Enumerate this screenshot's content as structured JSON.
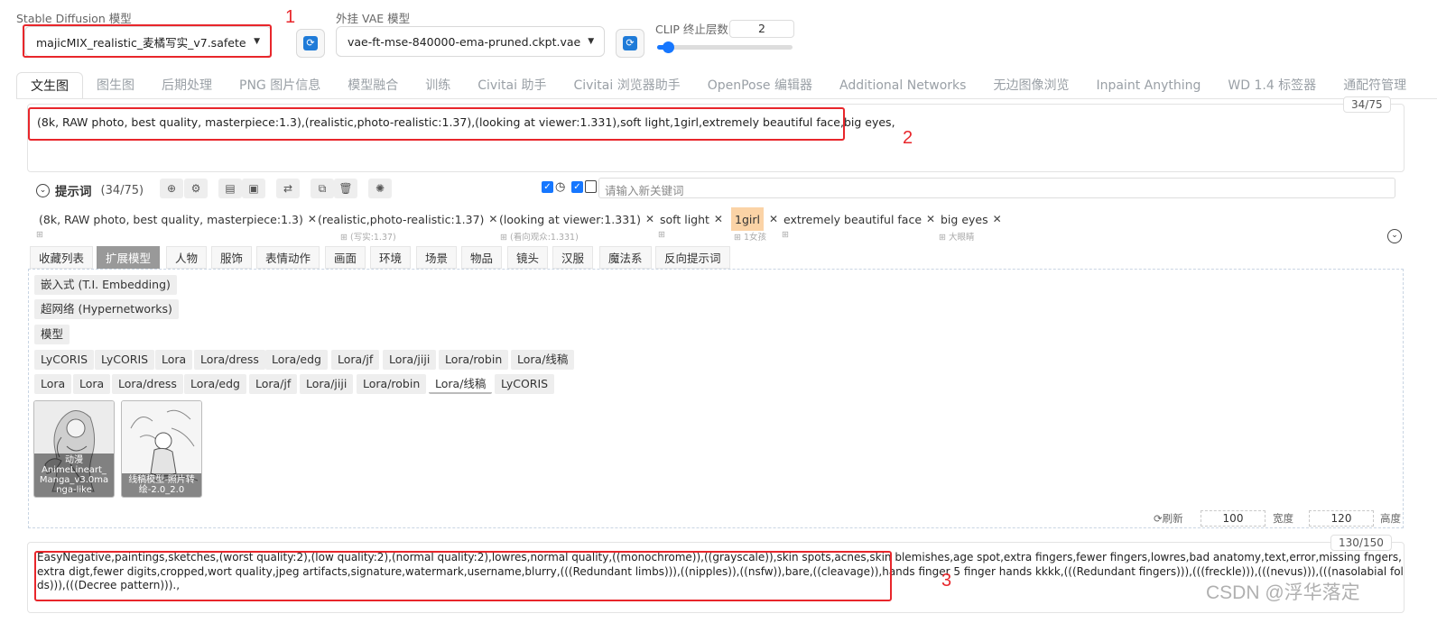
{
  "models": {
    "sd_label": "Stable Diffusion 模型",
    "sd_value": "majicMIX_realistic_麦橘写实_v7.safetensor",
    "vae_label": "外挂 VAE 模型",
    "vae_value": "vae-ft-mse-840000-ema-pruned.ckpt.vae",
    "clip_label": "CLIP 终止层数",
    "clip_value": "2",
    "clip_slider_fraction": 0.08
  },
  "tabs": [
    "文生图",
    "图生图",
    "后期处理",
    "PNG 图片信息",
    "模型融合",
    "训练",
    "Civitai 助手",
    "Civitai 浏览器助手",
    "OpenPose 编辑器",
    "Additional Networks",
    "无边图像浏览",
    "Inpaint Anything",
    "WD 1.4 标签器",
    "通配符管理"
  ],
  "annotations": {
    "n1": "1",
    "n2": "2",
    "n3": "3"
  },
  "prompt": {
    "text": "(8k, RAW photo, best quality, masterpiece:1.3),(realistic,photo-realistic:1.37),(looking at viewer:1.331),soft light,1girl,extremely beautiful face,big eyes,",
    "counter": "34/75"
  },
  "helper": {
    "title": "提示词",
    "count": "(34/75)",
    "keyword_placeholder": "请输入新关键词"
  },
  "tags": [
    {
      "text": "(8k, RAW photo, best quality, masterpiece:1.3)",
      "sub": ""
    },
    {
      "text": "(realistic,photo-realistic:1.37)",
      "sub": "(写实:1.37)"
    },
    {
      "text": "(looking at viewer:1.331)",
      "sub": "(看向观众:1.331)"
    },
    {
      "text": "soft light",
      "sub": ""
    },
    {
      "text": "1girl",
      "sub": "1女孩"
    },
    {
      "text": "extremely beautiful face",
      "sub": ""
    },
    {
      "text": "big eyes",
      "sub": "大眼睛"
    }
  ],
  "categories": [
    "收藏列表",
    "扩展模型",
    "人物",
    "服饰",
    "表情动作",
    "画面",
    "环境",
    "场景",
    "物品",
    "镜头",
    "汉服",
    "魔法系",
    "反向提示词"
  ],
  "ext_groups": {
    "embedding": "嵌入式 (T.I. Embedding)",
    "hypernetworks": "超网络 (Hypernetworks)",
    "model": "模型"
  },
  "row1": [
    "LyCORIS",
    "LyCORIS",
    "Lora",
    "Lora/dress",
    "Lora/edg",
    "Lora/jf",
    "Lora/jiji",
    "Lora/robin",
    "Lora/线稿"
  ],
  "row2": [
    "Lora",
    "Lora",
    "Lora/dress",
    "Lora/edg",
    "Lora/jf",
    "Lora/jiji",
    "Lora/robin",
    "Lora/线稿",
    "LyCORIS"
  ],
  "cards": [
    {
      "caption": "动漫 AnimeLineart_ Manga_v3.0ma nga-like"
    },
    {
      "caption": "线稿模型-照片转 绘-2.0_2.0"
    }
  ],
  "footer": {
    "refresh": "刷新",
    "width_value": "100",
    "width_label": "宽度",
    "height_value": "120",
    "height_label": "高度"
  },
  "negative": {
    "text": "EasyNegative,paintings,sketches,(worst quality:2),(low quality:2),(normal quality:2),lowres,normal quality,((monochrome)),((grayscale)),skin spots,acnes,skin blemishes,age spot,extra fingers,fewer fingers,lowres,bad anatomy,text,error,missing fngers,extra digt,fewer digits,cropped,wort quality,jpeg artifacts,signature,watermark,username,blurry,(((Redundant limbs))),((nipples)),((nsfw)),bare,((cleavage)),hands finger 5 finger hands kkkk,(((Redundant fingers))),(((freckle))),(((nevus))),(((nasolabial folds))),(((Decree pattern))).,",
    "counter": "130/150"
  },
  "watermark": "CSDN @浮华落定"
}
